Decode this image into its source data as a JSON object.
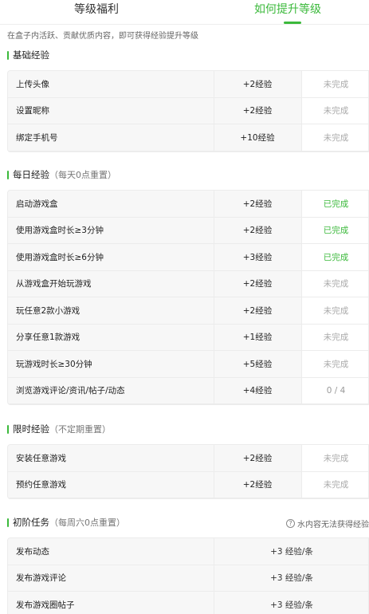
{
  "tabs": [
    {
      "label": "等级福利"
    },
    {
      "label": "如何提升等级"
    }
  ],
  "intro": "在盒子内活跃、贡献优质内容，即可获得经验提升等级",
  "sections": [
    {
      "title": "基础经验",
      "subtitle": "",
      "rows": [
        {
          "name": "上传头像",
          "reward": "+2经验",
          "status": "未完成"
        },
        {
          "name": "设置昵称",
          "reward": "+2经验",
          "status": "未完成"
        },
        {
          "name": "绑定手机号",
          "reward": "+10经验",
          "status": "未完成"
        }
      ]
    },
    {
      "title": "每日经验",
      "subtitle": "（每天0点重置）",
      "rows": [
        {
          "name": "启动游戏盒",
          "reward": "+2经验",
          "status": "已完成"
        },
        {
          "name": "使用游戏盒时长≥3分钟",
          "reward": "+2经验",
          "status": "已完成"
        },
        {
          "name": "使用游戏盒时长≥6分钟",
          "reward": "+3经验",
          "status": "已完成"
        },
        {
          "name": "从游戏盒开始玩游戏",
          "reward": "+2经验",
          "status": "未完成"
        },
        {
          "name": "玩任意2款小游戏",
          "reward": "+2经验",
          "status": "未完成"
        },
        {
          "name": "分享任意1款游戏",
          "reward": "+1经验",
          "status": "未完成"
        },
        {
          "name": "玩游戏时长≥30分钟",
          "reward": "+5经验",
          "status": "未完成"
        },
        {
          "name": "浏览游戏评论/资讯/帖子/动态",
          "reward": "+4经验",
          "status": "0 / 4"
        }
      ]
    },
    {
      "title": "限时经验",
      "subtitle": "（不定期重置）",
      "rows": [
        {
          "name": "安装任意游戏",
          "reward": "+2经验",
          "status": "未完成"
        },
        {
          "name": "预约任意游戏",
          "reward": "+2经验",
          "status": "未完成"
        }
      ]
    },
    {
      "title": "初阶任务",
      "subtitle": "（每周六0点重置）",
      "help": "水内容无法获得经验",
      "rows": [
        {
          "name": "发布动态",
          "reward": "+3 经验/条"
        },
        {
          "name": "发布游戏评论",
          "reward": "+3 经验/条"
        },
        {
          "name": "发布游戏圈帖子",
          "reward": "+3 经验/条"
        }
      ]
    }
  ],
  "colors": {
    "accent": "#3bb93b",
    "pending": "#aaaaaa"
  }
}
